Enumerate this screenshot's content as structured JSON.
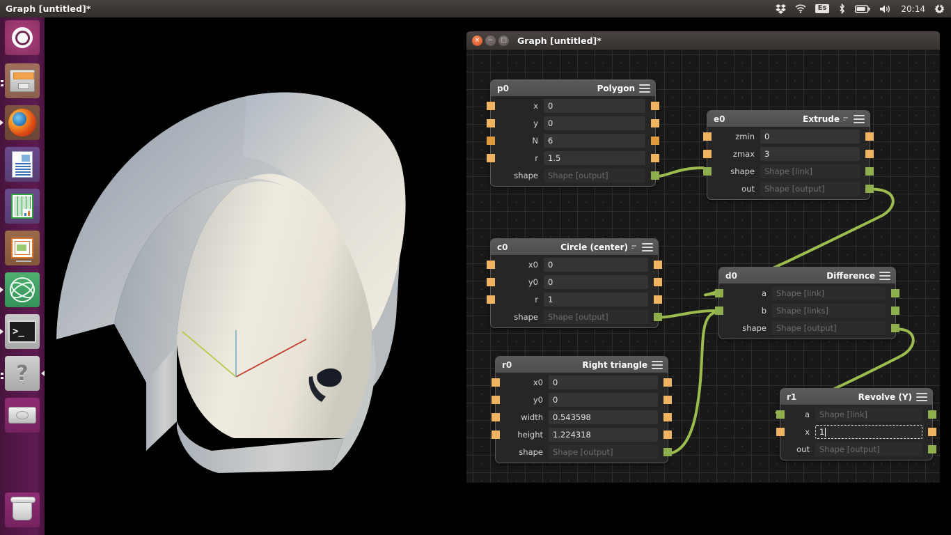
{
  "top_panel": {
    "window_title": "Graph [untitled]*",
    "indicators": [
      {
        "name": "dropbox-icon",
        "glyph": "✸"
      },
      {
        "name": "wifi-icon",
        "glyph": "◐"
      },
      {
        "name": "keyboard-layout-indicator",
        "label": "Es"
      },
      {
        "name": "bluetooth-icon",
        "glyph": "ᛦ"
      },
      {
        "name": "battery-icon",
        "glyph": "▭"
      },
      {
        "name": "volume-icon",
        "glyph": "🔊"
      }
    ],
    "clock": "20:14",
    "session_menu": "⚙"
  },
  "launcher": {
    "items": [
      {
        "name": "ubuntu-dash-icon",
        "label": "Ubuntu Dash",
        "running": false,
        "focused": false
      },
      {
        "name": "files-icon",
        "label": "Files",
        "running": true,
        "focused": false
      },
      {
        "name": "firefox-icon",
        "label": "Firefox Web Browser",
        "running": true,
        "focused": false
      },
      {
        "name": "libreoffice-writer-icon",
        "label": "LibreOffice Writer",
        "running": false,
        "focused": false
      },
      {
        "name": "libreoffice-calc-icon",
        "label": "LibreOffice Calc",
        "running": false,
        "focused": false
      },
      {
        "name": "libreoffice-impress-icon",
        "label": "LibreOffice Impress",
        "running": false,
        "focused": false
      },
      {
        "name": "atom-editor-icon",
        "label": "Atom",
        "running": true,
        "focused": false
      },
      {
        "name": "terminal-icon",
        "label": "Terminal",
        "running": true,
        "focused": false
      },
      {
        "name": "help-icon",
        "label": "Ubuntu Help",
        "running": true,
        "focused": true
      },
      {
        "name": "disk-icon",
        "label": "Disk",
        "running": false,
        "focused": false
      },
      {
        "name": "trash-icon",
        "label": "Trash",
        "running": false,
        "focused": false
      }
    ]
  },
  "graph_window": {
    "title": "Graph [untitled]*",
    "buttons": {
      "close": "×",
      "minimize": "−",
      "maximize": "□"
    },
    "nodes": [
      {
        "id": "p0",
        "type": "Polygon",
        "has_mini_icon": false,
        "rows": [
          {
            "label": "x",
            "value": "0",
            "kind": "value",
            "in_port": "orange",
            "out_port": "orange"
          },
          {
            "label": "y",
            "value": "0",
            "kind": "value",
            "in_port": "orange",
            "out_port": "orange"
          },
          {
            "label": "N",
            "value": "6",
            "kind": "value",
            "in_port": "orange-dk",
            "out_port": "orange-dk"
          },
          {
            "label": "r",
            "value": "1.5",
            "kind": "value",
            "in_port": "orange",
            "out_port": "orange"
          },
          {
            "label": "shape",
            "value": "Shape [output]",
            "kind": "placeholder",
            "in_port": "none",
            "out_port": "green"
          }
        ]
      },
      {
        "id": "e0",
        "type": "Extrude",
        "has_mini_icon": true,
        "rows": [
          {
            "label": "zmin",
            "value": "0",
            "kind": "value",
            "in_port": "orange",
            "out_port": "orange"
          },
          {
            "label": "zmax",
            "value": "3",
            "kind": "value",
            "in_port": "orange",
            "out_port": "orange"
          },
          {
            "label": "shape",
            "value": "Shape [link]",
            "kind": "placeholder",
            "in_port": "green",
            "out_port": "green"
          },
          {
            "label": "out",
            "value": "Shape [output]",
            "kind": "placeholder",
            "in_port": "none",
            "out_port": "green"
          }
        ]
      },
      {
        "id": "c0",
        "type": "Circle (center)",
        "has_mini_icon": true,
        "rows": [
          {
            "label": "x0",
            "value": "0",
            "kind": "value",
            "in_port": "orange",
            "out_port": "orange"
          },
          {
            "label": "y0",
            "value": "0",
            "kind": "value",
            "in_port": "orange",
            "out_port": "orange"
          },
          {
            "label": "r",
            "value": "1",
            "kind": "value",
            "in_port": "orange",
            "out_port": "orange"
          },
          {
            "label": "shape",
            "value": "Shape [output]",
            "kind": "placeholder",
            "in_port": "none",
            "out_port": "green"
          }
        ]
      },
      {
        "id": "d0",
        "type": "Difference",
        "has_mini_icon": false,
        "rows": [
          {
            "label": "a",
            "value": "Shape [link]",
            "kind": "placeholder",
            "in_port": "green",
            "out_port": "green"
          },
          {
            "label": "b",
            "value": "Shape [links]",
            "kind": "placeholder",
            "in_port": "green",
            "out_port": "green"
          },
          {
            "label": "shape",
            "value": "Shape [output]",
            "kind": "placeholder",
            "in_port": "none",
            "out_port": "green"
          }
        ]
      },
      {
        "id": "r0",
        "type": "Right triangle",
        "has_mini_icon": false,
        "rows": [
          {
            "label": "x0",
            "value": "0",
            "kind": "value",
            "in_port": "orange",
            "out_port": "orange"
          },
          {
            "label": "y0",
            "value": "0",
            "kind": "value",
            "in_port": "orange",
            "out_port": "orange"
          },
          {
            "label": "width",
            "value": "0.543598",
            "kind": "value",
            "in_port": "orange",
            "out_port": "orange"
          },
          {
            "label": "height",
            "value": "1.224318",
            "kind": "value",
            "in_port": "orange",
            "out_port": "orange"
          },
          {
            "label": "shape",
            "value": "Shape [output]",
            "kind": "placeholder",
            "in_port": "none",
            "out_port": "green"
          }
        ]
      },
      {
        "id": "r1",
        "type": "Revolve (Y)",
        "has_mini_icon": false,
        "rows": [
          {
            "label": "a",
            "value": "Shape [link]",
            "kind": "placeholder",
            "in_port": "green",
            "out_port": "green"
          },
          {
            "label": "x",
            "value": "1",
            "kind": "editing",
            "in_port": "orange",
            "out_port": "orange"
          },
          {
            "label": "out",
            "value": "Shape [output]",
            "kind": "placeholder",
            "in_port": "none",
            "out_port": "green"
          }
        ]
      }
    ],
    "connections": [
      {
        "from": "p0.shape",
        "to": "e0.shape"
      },
      {
        "from": "e0.out",
        "to": "d0.a"
      },
      {
        "from": "c0.shape",
        "to": "d0.b"
      },
      {
        "from": "r0.shape",
        "to": "d0.b"
      },
      {
        "from": "d0.shape",
        "to": "r1.a"
      }
    ],
    "colors": {
      "wire": "#9cbd4e",
      "port_shape": "#8fae4e",
      "port_float": "#f0b461",
      "canvas_bg": "#181818",
      "node_bg": "#262626",
      "node_head": "#545454"
    }
  },
  "viewport": {
    "name": "3d-render-viewport",
    "background": "#000000",
    "axes": {
      "x": "#c0392b",
      "y": "#b9c84a",
      "z": "#7fb6cf"
    },
    "material": "#e8e3d8"
  }
}
